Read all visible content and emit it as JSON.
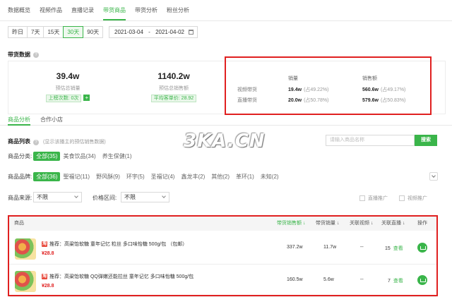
{
  "tabs": [
    "数据概览",
    "视频作品",
    "直播记录",
    "带货商品",
    "带货分析",
    "粉丝分析"
  ],
  "active_tab_index": 3,
  "range_buttons": [
    "昨日",
    "7天",
    "15天",
    "30天",
    "90天"
  ],
  "active_range_index": 3,
  "date_range": {
    "start": "2021-03-04",
    "sep": "-",
    "end": "2021-04-02"
  },
  "section_title": "带货数据",
  "stats": {
    "sales": {
      "value": "39.4w",
      "label": "预估总销量",
      "chip": "上榜次数: 0次"
    },
    "amount": {
      "value": "1140.2w",
      "label": "预估总销售额",
      "chip": "平均客单价: 28.92"
    }
  },
  "split": {
    "headers": [
      "销量",
      "销售额"
    ],
    "rows": [
      {
        "name": "视频带货",
        "qty": "19.4w",
        "qty_pct": "(占49.22%)",
        "amt": "560.6w",
        "amt_pct": "(占49.17%)"
      },
      {
        "name": "直播带货",
        "qty": "20.0w",
        "qty_pct": "(占50.78%)",
        "amt": "579.6w",
        "amt_pct": "(占50.83%)"
      }
    ]
  },
  "subtabs": [
    "商品分析",
    "合作小店"
  ],
  "list": {
    "title": "商品列表",
    "hint": "(显示该播主的预估销售数据)"
  },
  "watermark": "3KA.CN",
  "search": {
    "placeholder": "请输入商品名称",
    "button": "搜索"
  },
  "filter_category": {
    "label": "商品分类:",
    "options": [
      "全部(35)",
      "美食饮品(34)",
      "养生保健(1)"
    ]
  },
  "filter_brand": {
    "label": "商品品牌:",
    "options": [
      "全部(36)",
      "聖福记(11)",
      "野风酥(9)",
      "环宇(5)",
      "圣福记(4)",
      "鑫龙丰(2)",
      "其他(2)",
      "革环(1)",
      "未知(2)"
    ]
  },
  "filter_source": {
    "label": "商品来源:",
    "value": "不限"
  },
  "filter_price": {
    "label": "价格区间:",
    "value": "不限"
  },
  "checkboxes": [
    "直播推广",
    "视频推广"
  ],
  "table": {
    "headers": [
      "商品",
      "带货销售额 ↓",
      "带货销量 ↓",
      "关联视频 ↓",
      "关联直播 ↓",
      "操作"
    ],
    "rows": [
      {
        "title": "推荐：高粱饴软糖 童年记忆 粒丝 多口味怡糖 500g/包 （包邮）",
        "price": "¥28.8",
        "sales_amount": "337.2w",
        "sales_qty": "11.7w",
        "videos": "--",
        "lives": "15",
        "view": "查看"
      },
      {
        "title": "推荐：高粱饴软糖 QQ弹嫩还能拉丝 童年记忆 多口味怡糖 500g/包",
        "price": "¥28.8",
        "sales_amount": "160.5w",
        "sales_qty": "5.6w",
        "videos": "--",
        "lives": "7",
        "view": "查看"
      }
    ]
  }
}
